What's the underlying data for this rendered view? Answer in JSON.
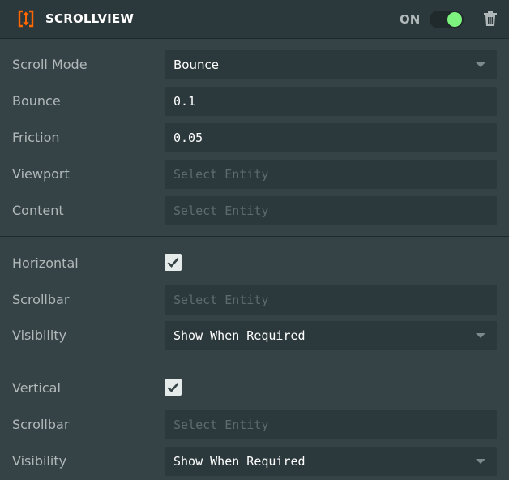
{
  "header": {
    "title": "SCROLLVIEW",
    "toggle_label": "ON",
    "toggle_state": true,
    "accent_color": "#f60",
    "toggle_color": "#7ef27e"
  },
  "general": {
    "scroll_mode": {
      "label": "Scroll Mode",
      "value": "Bounce"
    },
    "bounce": {
      "label": "Bounce",
      "value": "0.1"
    },
    "friction": {
      "label": "Friction",
      "value": "0.05"
    },
    "viewport": {
      "label": "Viewport",
      "placeholder": "Select Entity"
    },
    "content": {
      "label": "Content",
      "placeholder": "Select Entity"
    }
  },
  "horizontal": {
    "label": "Horizontal",
    "checked": true,
    "scrollbar": {
      "label": "Scrollbar",
      "placeholder": "Select Entity"
    },
    "visibility": {
      "label": "Visibility",
      "value": "Show When Required"
    }
  },
  "vertical": {
    "label": "Vertical",
    "checked": true,
    "scrollbar": {
      "label": "Scrollbar",
      "placeholder": "Select Entity"
    },
    "visibility": {
      "label": "Visibility",
      "value": "Show When Required"
    }
  }
}
